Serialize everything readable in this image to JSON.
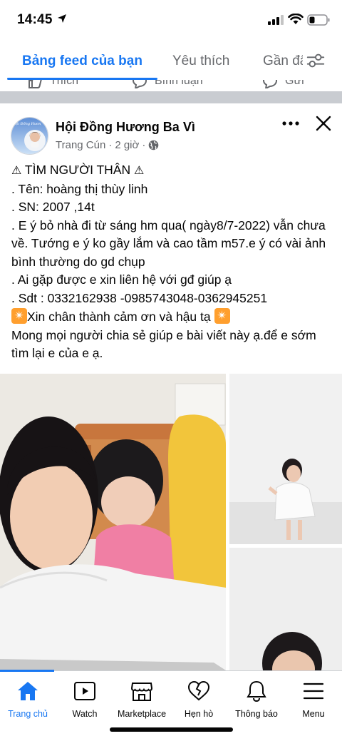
{
  "status_bar": {
    "time": "14:45"
  },
  "tabs": [
    {
      "label": "Bảng feed của bạn",
      "active": true
    },
    {
      "label": "Yêu thích",
      "active": false
    },
    {
      "label": "Gần đây",
      "active": false
    }
  ],
  "previous_post": {
    "like_label": "Thích",
    "comment_label": "Bình luận",
    "share_label": "Gửi"
  },
  "post": {
    "group_name": "Hội Đồng Hương Ba Vì",
    "author": "Trang Cún",
    "time": "2 giờ",
    "avatar_text": "Hội Đồng Hương",
    "lines": {
      "l1": "TÌM NGƯỜI THÂN",
      "l2": ". Tên: hoàng thị thùy linh",
      "l3": ". SN: 2007 ,14t",
      "l4": ". E ý bỏ nhà đi từ sáng hm qua( ngày8/7-2022) vẫn chưa về. Tướng e ý ko gầy lắm và cao tầm m57.e ý có vài  ảnh bình thường do gd chụp",
      "l5": ". Ai gặp được e xin liên hệ với gđ giúp ạ",
      "l6": ". Sdt : 0332162938 -0985743048-0362945251",
      "l7": "Xin chân thành cảm ơn và hậu tạ",
      "l8": "Mong mọi người chia sẻ giúp e bài viết này ạ.để e sớm tìm lại e của e ạ."
    },
    "photos": [
      {
        "icon": "photo-girl-and-child"
      },
      {
        "icon": "photo-girl-white-dress"
      },
      {
        "icon": "photo-girl-portrait"
      }
    ]
  },
  "bottom_nav": [
    {
      "label": "Trang chủ",
      "icon": "home-icon",
      "active": true
    },
    {
      "label": "Watch",
      "icon": "watch-icon",
      "active": false
    },
    {
      "label": "Marketplace",
      "icon": "marketplace-icon",
      "active": false
    },
    {
      "label": "Hẹn hò",
      "icon": "dating-icon",
      "active": false
    },
    {
      "label": "Thông báo",
      "icon": "bell-icon",
      "active": false
    },
    {
      "label": "Menu",
      "icon": "menu-icon",
      "active": false
    }
  ],
  "colors": {
    "accent": "#1877f2",
    "secondary_text": "#65676b",
    "divider": "#c9ccd1",
    "spark": "#ff9f2e"
  }
}
